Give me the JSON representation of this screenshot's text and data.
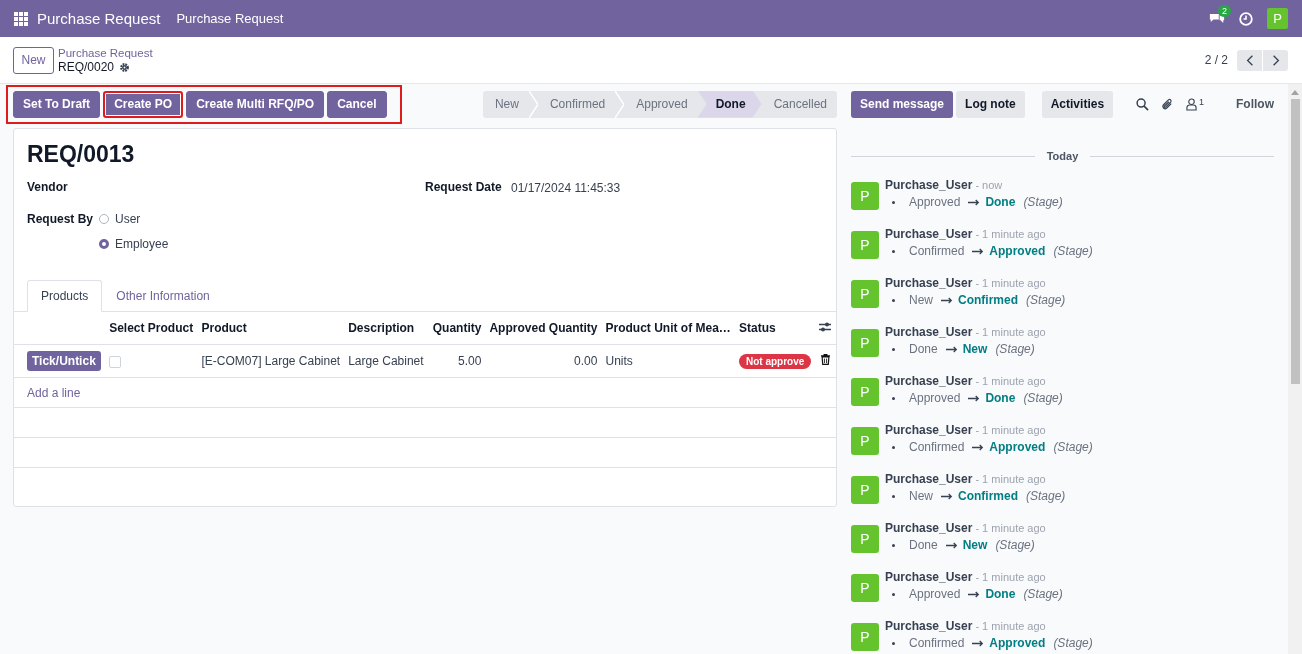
{
  "navbar": {
    "app_title": "Purchase Request",
    "menu": [
      "Purchase Request"
    ],
    "message_count": "2",
    "avatar": "P"
  },
  "control_panel": {
    "new_button": "New",
    "parent": "Purchase Request",
    "current": "REQ/0020",
    "pager": "2 / 2"
  },
  "action_buttons": [
    {
      "label": "Set To Draft",
      "highlighted": false
    },
    {
      "label": "Create PO",
      "highlighted": true
    },
    {
      "label": "Create Multi RFQ/PO",
      "highlighted": false
    },
    {
      "label": "Cancel",
      "highlighted": false
    }
  ],
  "action_buttons_annotated": true,
  "stages": [
    {
      "label": "New",
      "selected": false
    },
    {
      "label": "Confirmed",
      "selected": false
    },
    {
      "label": "Approved",
      "selected": false
    },
    {
      "label": "Done",
      "selected": true
    },
    {
      "label": "Cancelled",
      "selected": false
    }
  ],
  "form": {
    "title": "REQ/0013",
    "vendor_label": "Vendor",
    "request_date_label": "Request Date",
    "request_date": "01/17/2024 11:45:33",
    "request_by_label": "Request By",
    "request_by_options": [
      {
        "label": "User",
        "selected": false
      },
      {
        "label": "Employee",
        "selected": true
      }
    ],
    "tabs": [
      {
        "label": "Products",
        "selected": true
      },
      {
        "label": "Other Information",
        "selected": false
      }
    ],
    "table": {
      "columns": [
        "Select Product",
        "Product",
        "Description",
        "Quantity",
        "Approved Quantity",
        "Product Unit of Mea…",
        "Status"
      ],
      "rows": [
        {
          "button": "Tick/Untick",
          "checked": false,
          "product": "[E-COM07] Large Cabinet",
          "description": "Large Cabinet",
          "quantity": "5.00",
          "approved_quantity": "0.00",
          "uom": "Units",
          "status": "Not approve"
        }
      ],
      "add_line": "Add a line"
    }
  },
  "chatter": {
    "send_message": "Send message",
    "log_note": "Log note",
    "activities": "Activities",
    "follower_count": "1",
    "follow": "Follow",
    "date_separator": "Today",
    "messages": [
      {
        "avatar": "P",
        "author": "Purchase_User",
        "time": "- now",
        "old": "Approved",
        "new": "Done",
        "field": "(Stage)"
      },
      {
        "avatar": "P",
        "author": "Purchase_User",
        "time": "- 1 minute ago",
        "old": "Confirmed",
        "new": "Approved",
        "field": "(Stage)"
      },
      {
        "avatar": "P",
        "author": "Purchase_User",
        "time": "- 1 minute ago",
        "old": "New",
        "new": "Confirmed",
        "field": "(Stage)"
      },
      {
        "avatar": "P",
        "author": "Purchase_User",
        "time": "- 1 minute ago",
        "old": "Done",
        "new": "New",
        "field": "(Stage)"
      },
      {
        "avatar": "P",
        "author": "Purchase_User",
        "time": "- 1 minute ago",
        "old": "Approved",
        "new": "Done",
        "field": "(Stage)"
      },
      {
        "avatar": "P",
        "author": "Purchase_User",
        "time": "- 1 minute ago",
        "old": "Confirmed",
        "new": "Approved",
        "field": "(Stage)"
      },
      {
        "avatar": "P",
        "author": "Purchase_User",
        "time": "- 1 minute ago",
        "old": "New",
        "new": "Confirmed",
        "field": "(Stage)"
      },
      {
        "avatar": "P",
        "author": "Purchase_User",
        "time": "- 1 minute ago",
        "old": "Done",
        "new": "New",
        "field": "(Stage)"
      },
      {
        "avatar": "P",
        "author": "Purchase_User",
        "time": "- 1 minute ago",
        "old": "Approved",
        "new": "Done",
        "field": "(Stage)"
      },
      {
        "avatar": "P",
        "author": "Purchase_User",
        "time": "- 1 minute ago",
        "old": "Confirmed",
        "new": "Approved",
        "field": "(Stage)"
      }
    ]
  }
}
